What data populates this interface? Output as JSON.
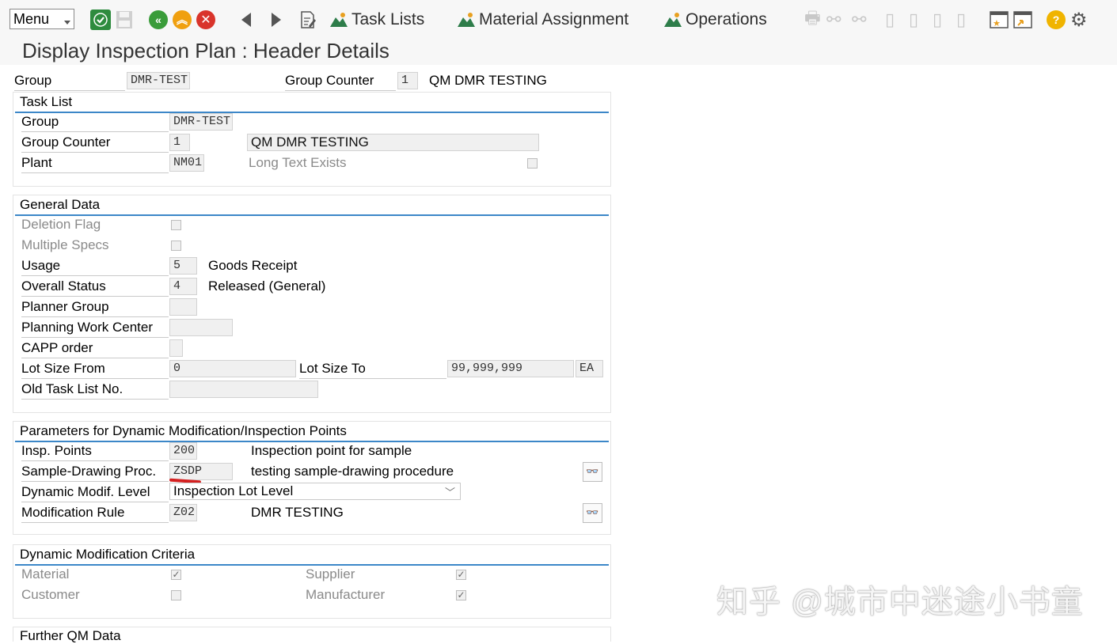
{
  "toolbar": {
    "menu_label": "Menu",
    "task_lists": "Task Lists",
    "material_assignment": "Material Assignment",
    "operations": "Operations"
  },
  "page": {
    "title": "Display Inspection Plan : Header Details"
  },
  "header": {
    "group_label": "Group",
    "group_value": "DMR-TEST",
    "counter_label": "Group Counter",
    "counter_value": "1",
    "description": "QM DMR TESTING"
  },
  "task_list": {
    "title": "Task List",
    "group_label": "Group",
    "group_value": "DMR-TEST",
    "counter_label": "Group Counter",
    "counter_value": "1",
    "counter_desc": "QM DMR TESTING",
    "plant_label": "Plant",
    "plant_value": "NM01",
    "long_text_label": "Long Text Exists"
  },
  "general": {
    "title": "General Data",
    "deletion_flag": "Deletion Flag",
    "multiple_specs": "Multiple Specs",
    "usage_label": "Usage",
    "usage_value": "5",
    "usage_desc": "Goods Receipt",
    "status_label": "Overall Status",
    "status_value": "4",
    "status_desc": "Released (General)",
    "planner_group": "Planner Group",
    "planning_wc": "Planning Work Center",
    "capp_order": "CAPP order",
    "lot_from_label": "Lot Size From",
    "lot_from_value": "0",
    "lot_to_label": "Lot Size To",
    "lot_to_value": "99,999,999",
    "unit": "EA",
    "old_task_list": "Old Task List No."
  },
  "dynamic": {
    "title": "Parameters for Dynamic Modification/Inspection Points",
    "insp_points_label": "Insp. Points",
    "insp_points_value": "200",
    "insp_points_desc": "Inspection point for sample",
    "sdp_label": "Sample-Drawing Proc.",
    "sdp_value": "ZSDP",
    "sdp_desc": "testing sample-drawing procedure",
    "level_label": "Dynamic Modif. Level",
    "level_value": "Inspection Lot Level",
    "rule_label": "Modification Rule",
    "rule_value": "Z02",
    "rule_desc": "DMR TESTING"
  },
  "criteria": {
    "title": "Dynamic Modification Criteria",
    "material": "Material",
    "supplier": "Supplier",
    "customer": "Customer",
    "manufacturer": "Manufacturer"
  },
  "further": {
    "title": "Further QM Data"
  },
  "watermark": "知乎 @城市中迷途小书童",
  "colors": {
    "accent": "#3c87c8",
    "check_green": "#2e8b3e",
    "nav_green": "#3a9c3a",
    "nav_orange": "#f0a010",
    "cancel_red": "#d9342b",
    "help_yellow": "#f0b400"
  }
}
